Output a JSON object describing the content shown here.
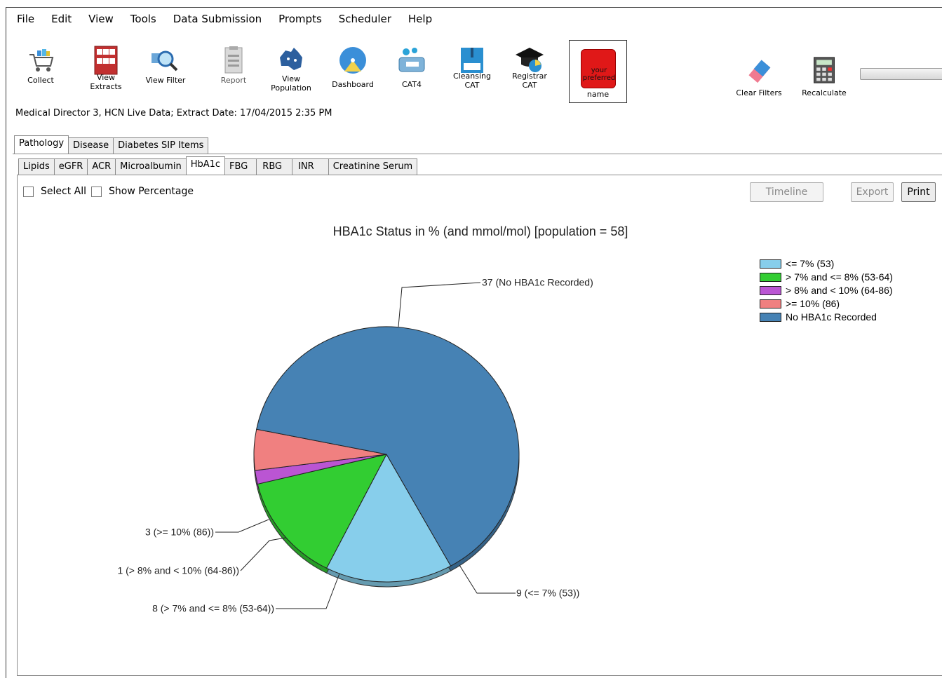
{
  "menu": [
    "File",
    "Edit",
    "View",
    "Tools",
    "Data Submission",
    "Prompts",
    "Scheduler",
    "Help"
  ],
  "toolbar": {
    "collect": "Collect",
    "view_extracts": "View\nExtracts",
    "view_filter": "View Filter",
    "report": "Report",
    "view_population": "View\nPopulation",
    "dashboard": "Dashboard",
    "cat4": "CAT4",
    "cleansing_cat": "Cleansing\nCAT",
    "registrar_cat": "Registrar\nCAT",
    "preferred_name": "name",
    "preferred_icon_text": "your preferred",
    "clear_filters": "Clear Filters",
    "recalculate": "Recalculate"
  },
  "info_line": "Medical Director 3, HCN Live Data; Extract Date: 17/04/2015 2:35 PM",
  "main_tabs": [
    "Pathology",
    "Disease",
    "Diabetes SIP Items"
  ],
  "sub_tabs": [
    "Lipids",
    "eGFR",
    "ACR",
    "Microalbumin",
    "HbA1c",
    "FBG",
    "RBG",
    "INR",
    "Creatinine Serum"
  ],
  "controls": {
    "select_all": "Select All",
    "show_percentage": "Show Percentage",
    "timeline": "Timeline",
    "export": "Export",
    "print": "Print"
  },
  "chart_data": {
    "type": "pie",
    "title": "HBA1c Status in % (and mmol/mol) [population = 58]",
    "series": [
      {
        "name": "<= 7% (53)",
        "value": 9,
        "label": "9 (<= 7% (53))",
        "color": "#87ceeb"
      },
      {
        "name": "> 7% and <= 8% (53-64)",
        "value": 8,
        "label": "8 (> 7% and <= 8% (53-64))",
        "color": "#32cd32"
      },
      {
        "name": "> 8% and < 10% (64-86)",
        "value": 1,
        "label": "1 (> 8% and < 10% (64-86))",
        "color": "#ba55d3"
      },
      {
        "name": ">= 10% (86)",
        "value": 3,
        "label": "3 (>= 10% (86))",
        "color": "#f08080"
      },
      {
        "name": "No HBA1c Recorded",
        "value": 37,
        "label": "37 (No HBA1c Recorded)",
        "color": "#4682b4"
      }
    ],
    "legend_position": "top-right"
  }
}
